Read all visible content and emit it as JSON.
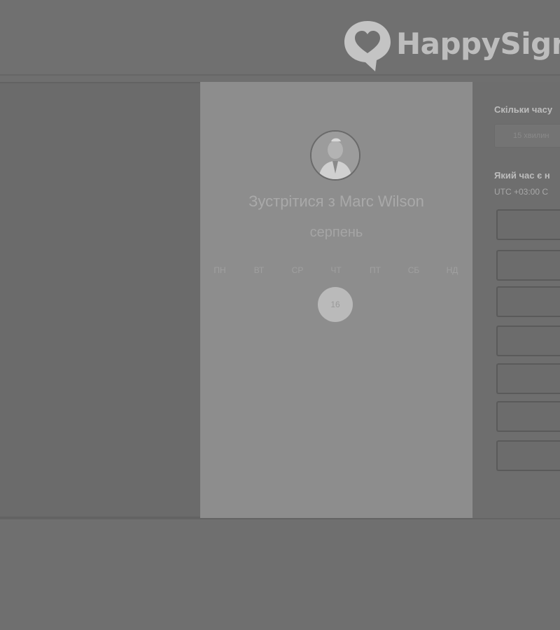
{
  "brand": {
    "name": "HappySign"
  },
  "card": {
    "title": "Зустрітися з Marc Wilson",
    "month": "серпень",
    "weekdays": [
      "ПН",
      "ВТ",
      "СР",
      "ЧТ",
      "ПТ",
      "СБ",
      "НД"
    ],
    "selected_day": "16"
  },
  "right_panel": {
    "duration_label": "Скільки часу",
    "duration_value": "15 хвилин",
    "time_label": "Який час є н",
    "timezone": "UTC +03:00 С"
  }
}
